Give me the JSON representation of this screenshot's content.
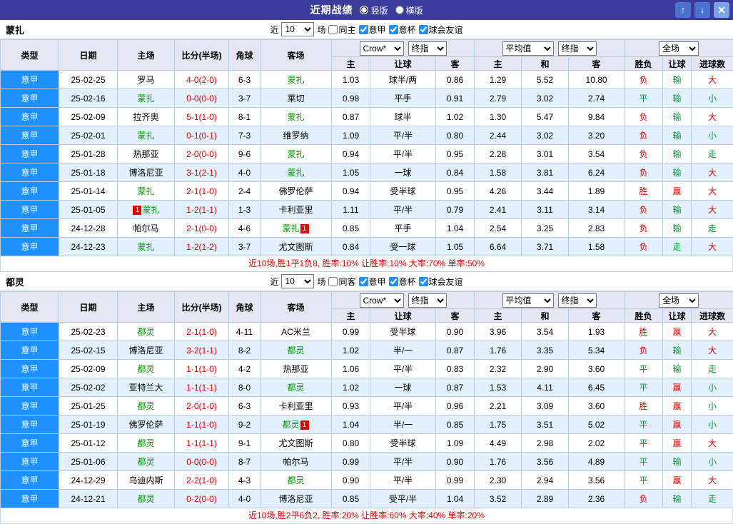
{
  "titlebar": {
    "title": "近期战绩",
    "layout_options": [
      {
        "label": "竖版",
        "selected": true
      },
      {
        "label": "横版",
        "selected": false
      }
    ],
    "buttons": {
      "up": "↑",
      "down": "↓",
      "close": "✕"
    }
  },
  "colors": {
    "titlebar_bg": "#3b3b9c",
    "league_cell_bg": "#1e90ff",
    "alt_row_bg": "#e2f1fd",
    "header_bg": "#e4e6f1",
    "win_red": "#e60000",
    "lose_green": "#009933",
    "focus_team_green": "#009900",
    "score_red": "#e60000"
  },
  "result_colors": {
    "胜": "#e60000",
    "负": "#e60000",
    "平": "#009933",
    "赢": "#e60000",
    "输": "#009933",
    "走": "#009933",
    "大": "#e60000",
    "小": "#009933"
  },
  "table_header": {
    "static_cols": [
      "类型",
      "日期",
      "主场",
      "比分(半场)",
      "角球",
      "客场"
    ],
    "group1": {
      "select_a": "Crow*",
      "select_b": "终指",
      "sub": [
        "主",
        "让球",
        "客"
      ]
    },
    "group2": {
      "select_a": "平均值",
      "select_b": "终指",
      "sub": [
        "主",
        "和",
        "客"
      ]
    },
    "group3": {
      "select": "全场",
      "sub": [
        "胜负",
        "让球",
        "进球数"
      ]
    }
  },
  "sections": [
    {
      "team": "蒙扎",
      "filter": {
        "prefix": "近",
        "count": "10",
        "suffix": "场",
        "checkboxes": [
          {
            "label": "同主",
            "checked": false
          },
          {
            "label": "意甲",
            "checked": true
          },
          {
            "label": "意杯",
            "checked": true
          },
          {
            "label": "球会友谊",
            "checked": true
          }
        ]
      },
      "rows": [
        {
          "league": "意甲",
          "date": "25-02-25",
          "home": "罗马",
          "home_focus": false,
          "score": "4-0(2-0)",
          "corner": "6-3",
          "away": "蒙扎",
          "away_focus": true,
          "asia": [
            "1.03",
            "球半/两",
            "0.86"
          ],
          "euro": [
            "1.29",
            "5.52",
            "10.80"
          ],
          "results": [
            "负",
            "输",
            "大"
          ]
        },
        {
          "league": "意甲",
          "date": "25-02-16",
          "home": "蒙扎",
          "home_focus": true,
          "score": "0-0(0-0)",
          "corner": "3-7",
          "away": "莱切",
          "away_focus": false,
          "asia": [
            "0.98",
            "平手",
            "0.91"
          ],
          "euro": [
            "2.79",
            "3.02",
            "2.74"
          ],
          "results": [
            "平",
            "输",
            "小"
          ]
        },
        {
          "league": "意甲",
          "date": "25-02-09",
          "home": "拉齐奥",
          "home_focus": false,
          "score": "5-1(1-0)",
          "corner": "8-1",
          "away": "蒙扎",
          "away_focus": true,
          "asia": [
            "0.87",
            "球半",
            "1.02"
          ],
          "euro": [
            "1.30",
            "5.47",
            "9.84"
          ],
          "results": [
            "负",
            "输",
            "大"
          ]
        },
        {
          "league": "意甲",
          "date": "25-02-01",
          "home": "蒙扎",
          "home_focus": true,
          "score": "0-1(0-1)",
          "corner": "7-3",
          "away": "维罗纳",
          "away_focus": false,
          "asia": [
            "1.09",
            "平/半",
            "0.80"
          ],
          "euro": [
            "2.44",
            "3.02",
            "3.20"
          ],
          "results": [
            "负",
            "输",
            "小"
          ]
        },
        {
          "league": "意甲",
          "date": "25-01-28",
          "home": "热那亚",
          "home_focus": false,
          "score": "2-0(0-0)",
          "corner": "9-6",
          "away": "蒙扎",
          "away_focus": true,
          "asia": [
            "0.94",
            "平/半",
            "0.95"
          ],
          "euro": [
            "2.28",
            "3.01",
            "3.54"
          ],
          "results": [
            "负",
            "输",
            "走"
          ]
        },
        {
          "league": "意甲",
          "date": "25-01-18",
          "home": "博洛尼亚",
          "home_focus": false,
          "score": "3-1(2-1)",
          "corner": "4-0",
          "away": "蒙扎",
          "away_focus": true,
          "asia": [
            "1.05",
            "一球",
            "0.84"
          ],
          "euro": [
            "1.58",
            "3.81",
            "6.24"
          ],
          "results": [
            "负",
            "输",
            "大"
          ]
        },
        {
          "league": "意甲",
          "date": "25-01-14",
          "home": "蒙扎",
          "home_focus": true,
          "score": "2-1(1-0)",
          "corner": "2-4",
          "away": "佛罗伦萨",
          "away_focus": false,
          "asia": [
            "0.94",
            "受半球",
            "0.95"
          ],
          "euro": [
            "4.26",
            "3.44",
            "1.89"
          ],
          "results": [
            "胜",
            "赢",
            "大"
          ]
        },
        {
          "league": "意甲",
          "date": "25-01-05",
          "home": "蒙扎",
          "home_focus": true,
          "home_badge": "1",
          "home_badge_side": "left",
          "score": "1-2(1-1)",
          "corner": "1-3",
          "away": "卡利亚里",
          "away_focus": false,
          "asia": [
            "1.11",
            "平/半",
            "0.79"
          ],
          "euro": [
            "2.41",
            "3.11",
            "3.14"
          ],
          "results": [
            "负",
            "输",
            "大"
          ]
        },
        {
          "league": "意甲",
          "date": "24-12-28",
          "home": "帕尔马",
          "home_focus": false,
          "score": "2-1(0-0)",
          "corner": "4-6",
          "away": "蒙扎",
          "away_focus": true,
          "away_badge": "1",
          "away_badge_side": "right",
          "asia": [
            "0.85",
            "平手",
            "1.04"
          ],
          "euro": [
            "2.54",
            "3.25",
            "2.83"
          ],
          "results": [
            "负",
            "输",
            "走"
          ]
        },
        {
          "league": "意甲",
          "date": "24-12-23",
          "home": "蒙扎",
          "home_focus": true,
          "score": "1-2(1-2)",
          "corner": "3-7",
          "away": "尤文图斯",
          "away_focus": false,
          "asia": [
            "0.84",
            "受一球",
            "1.05"
          ],
          "euro": [
            "6.64",
            "3.71",
            "1.58"
          ],
          "results": [
            "负",
            "走",
            "大"
          ]
        }
      ],
      "summary": "近10场,胜1平1负8, 胜率:10% 让胜率:10% 大率:70% 单率:50%"
    },
    {
      "team": "都灵",
      "filter": {
        "prefix": "近",
        "count": "10",
        "suffix": "场",
        "checkboxes": [
          {
            "label": "同客",
            "checked": false
          },
          {
            "label": "意甲",
            "checked": true
          },
          {
            "label": "意杯",
            "checked": true
          },
          {
            "label": "球会友谊",
            "checked": true
          }
        ]
      },
      "rows": [
        {
          "league": "意甲",
          "date": "25-02-23",
          "home": "都灵",
          "home_focus": true,
          "score": "2-1(1-0)",
          "corner": "4-11",
          "away": "AC米兰",
          "away_focus": false,
          "asia": [
            "0.99",
            "受半球",
            "0.90"
          ],
          "euro": [
            "3.96",
            "3.54",
            "1.93"
          ],
          "results": [
            "胜",
            "赢",
            "大"
          ]
        },
        {
          "league": "意甲",
          "date": "25-02-15",
          "home": "博洛尼亚",
          "home_focus": false,
          "score": "3-2(1-1)",
          "corner": "8-2",
          "away": "都灵",
          "away_focus": true,
          "asia": [
            "1.02",
            "半/一",
            "0.87"
          ],
          "euro": [
            "1.76",
            "3.35",
            "5.34"
          ],
          "results": [
            "负",
            "输",
            "大"
          ]
        },
        {
          "league": "意甲",
          "date": "25-02-09",
          "home": "都灵",
          "home_focus": true,
          "score": "1-1(1-0)",
          "corner": "4-2",
          "away": "热那亚",
          "away_focus": false,
          "asia": [
            "1.06",
            "平/半",
            "0.83"
          ],
          "euro": [
            "2.32",
            "2.90",
            "3.60"
          ],
          "results": [
            "平",
            "输",
            "走"
          ]
        },
        {
          "league": "意甲",
          "date": "25-02-02",
          "home": "亚特兰大",
          "home_focus": false,
          "score": "1-1(1-1)",
          "corner": "8-0",
          "away": "都灵",
          "away_focus": true,
          "asia": [
            "1.02",
            "一球",
            "0.87"
          ],
          "euro": [
            "1.53",
            "4.11",
            "6.45"
          ],
          "results": [
            "平",
            "赢",
            "小"
          ]
        },
        {
          "league": "意甲",
          "date": "25-01-25",
          "home": "都灵",
          "home_focus": true,
          "score": "2-0(1-0)",
          "corner": "6-3",
          "away": "卡利亚里",
          "away_focus": false,
          "asia": [
            "0.93",
            "平/半",
            "0.96"
          ],
          "euro": [
            "2.21",
            "3.09",
            "3.60"
          ],
          "results": [
            "胜",
            "赢",
            "小"
          ]
        },
        {
          "league": "意甲",
          "date": "25-01-19",
          "home": "佛罗伦萨",
          "home_focus": false,
          "score": "1-1(1-0)",
          "corner": "9-2",
          "away": "都灵",
          "away_focus": true,
          "away_badge": "1",
          "away_badge_side": "right",
          "asia": [
            "1.04",
            "半/一",
            "0.85"
          ],
          "euro": [
            "1.75",
            "3.51",
            "5.02"
          ],
          "results": [
            "平",
            "赢",
            "小"
          ]
        },
        {
          "league": "意甲",
          "date": "25-01-12",
          "home": "都灵",
          "home_focus": true,
          "score": "1-1(1-1)",
          "corner": "9-1",
          "away": "尤文图斯",
          "away_focus": false,
          "asia": [
            "0.80",
            "受半球",
            "1.09"
          ],
          "euro": [
            "4.49",
            "2.98",
            "2.02"
          ],
          "results": [
            "平",
            "赢",
            "大"
          ]
        },
        {
          "league": "意甲",
          "date": "25-01-06",
          "home": "都灵",
          "home_focus": true,
          "score": "0-0(0-0)",
          "corner": "8-7",
          "away": "帕尔马",
          "away_focus": false,
          "asia": [
            "0.99",
            "平/半",
            "0.90"
          ],
          "euro": [
            "1.76",
            "3.56",
            "4.89"
          ],
          "results": [
            "平",
            "输",
            "小"
          ]
        },
        {
          "league": "意甲",
          "date": "24-12-29",
          "home": "乌迪内斯",
          "home_focus": false,
          "score": "2-2(1-0)",
          "corner": "4-3",
          "away": "都灵",
          "away_focus": true,
          "asia": [
            "0.90",
            "平/半",
            "0.99"
          ],
          "euro": [
            "2.30",
            "2.94",
            "3.56"
          ],
          "results": [
            "平",
            "赢",
            "大"
          ]
        },
        {
          "league": "意甲",
          "date": "24-12-21",
          "home": "都灵",
          "home_focus": true,
          "score": "0-2(0-0)",
          "corner": "4-0",
          "away": "博洛尼亚",
          "away_focus": false,
          "asia": [
            "0.85",
            "受平/半",
            "1.04"
          ],
          "euro": [
            "3.52",
            "2.89",
            "2.36"
          ],
          "results": [
            "负",
            "输",
            "走"
          ]
        }
      ],
      "summary": "近10场,胜2平6负2, 胜率:20% 让胜率:60% 大率:40% 单率:20%"
    }
  ]
}
